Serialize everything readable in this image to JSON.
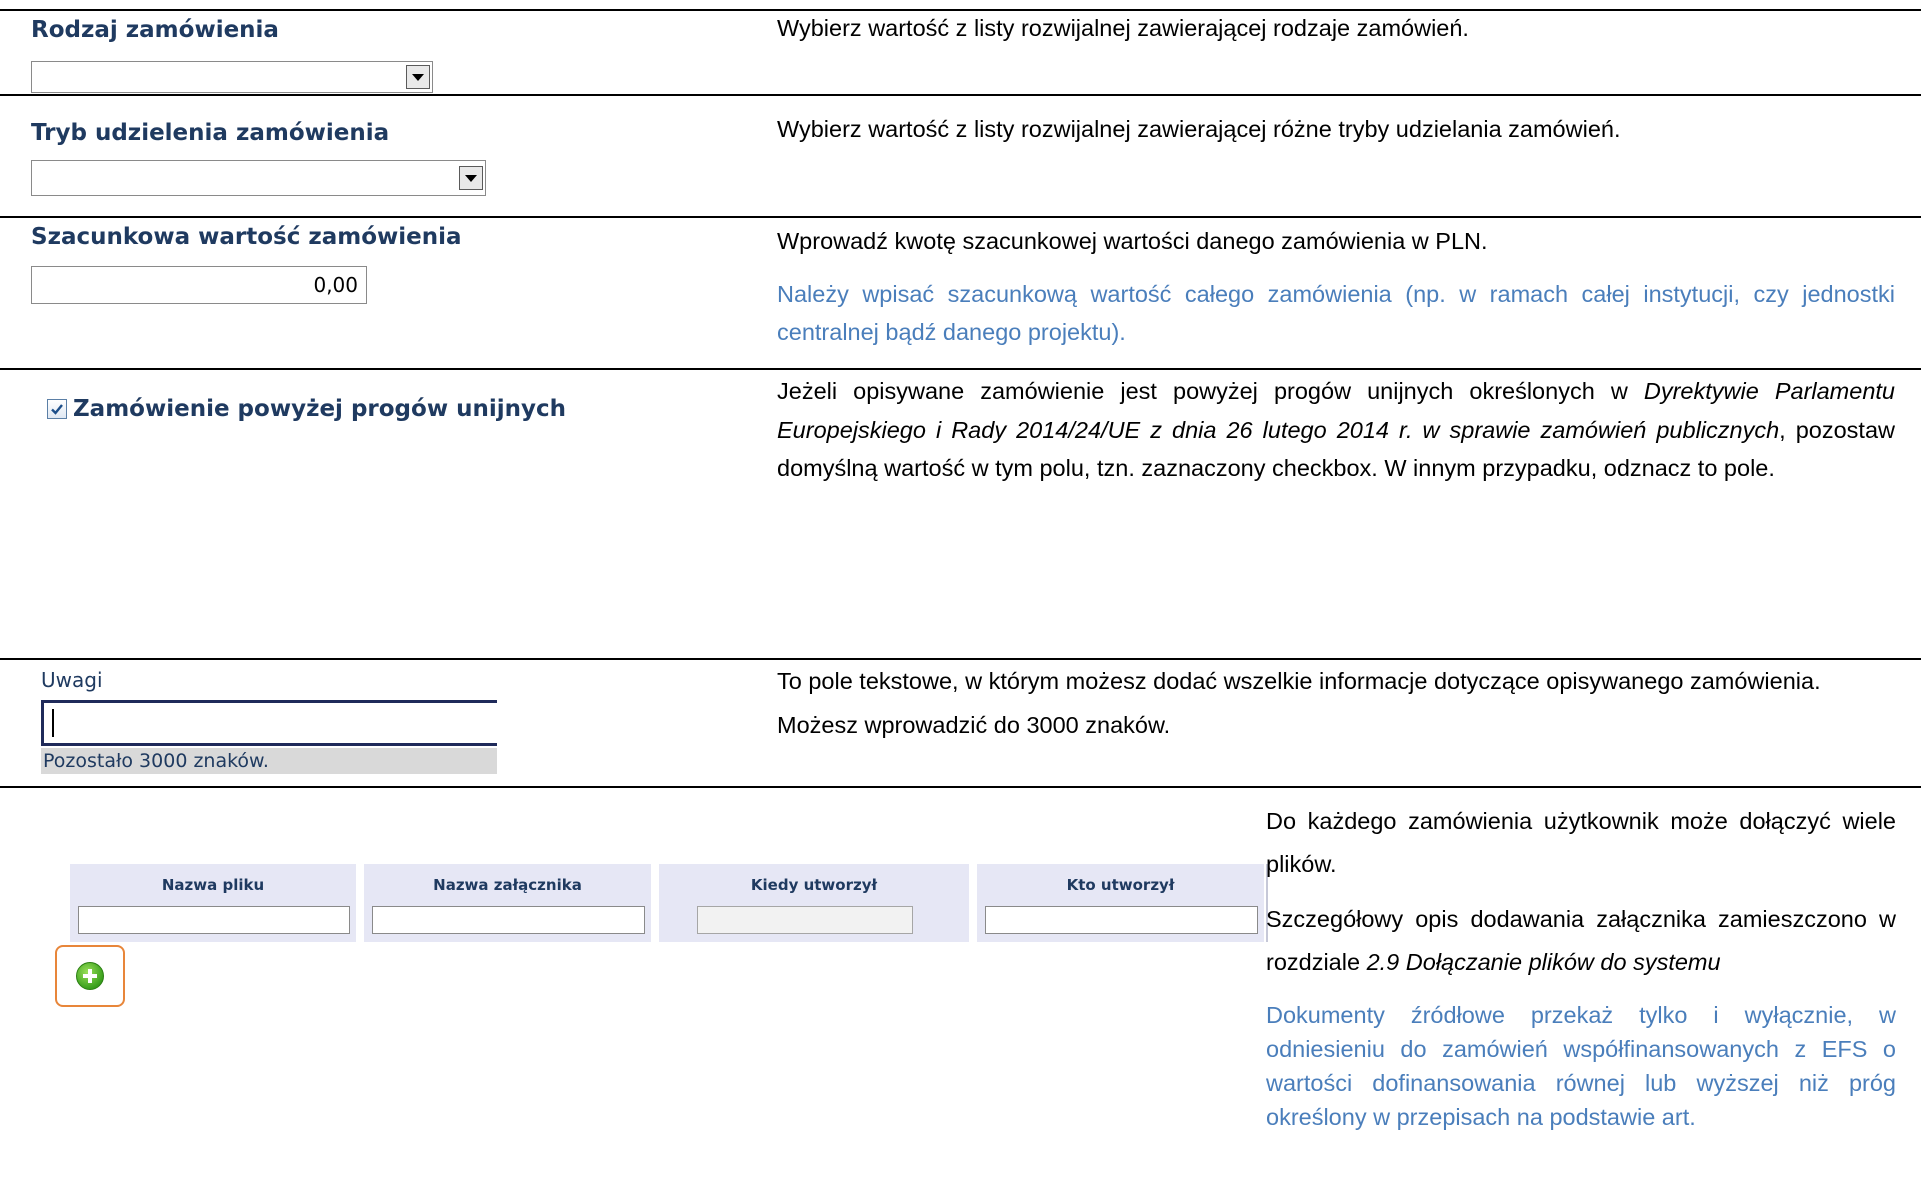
{
  "rodzaj": {
    "label": "Rodzaj zamówienia",
    "selected": "",
    "desc": "Wybierz wartość z listy rozwijalnej zawierającej rodzaje zamówień."
  },
  "tryb": {
    "label": "Tryb udzielenia zamówienia",
    "selected": "",
    "desc": "Wybierz wartość z listy rozwijalnej zawierającej różne tryby udzielania zamówień."
  },
  "szacunkowa": {
    "label": "Szacunkowa wartość zamówienia",
    "value": "0,00",
    "desc": "Wprowadź kwotę szacunkowej wartości danego zamówienia w PLN.",
    "note": "Należy wpisać szacunkową wartość całego zamówienia (np. w ramach całej instytucji, czy jednostki centralnej bądź danego projektu)."
  },
  "progi": {
    "label": "Zamówienie powyżej progów unijnych",
    "checked": true,
    "desc_1": "Jeżeli opisywane zamówienie jest powyżej progów unijnych określonych w ",
    "desc_italic": "Dyrektywie Parlamentu Europejskiego i Rady 2014/24/UE z dnia 26 lutego 2014 r. w sprawie zamówień publicznych",
    "desc_2": ", pozostaw domyślną wartość w tym polu, tzn. zaznaczony checkbox. W innym przypadku, odznacz to pole."
  },
  "uwagi": {
    "label": "Uwagi",
    "value": "",
    "remaining": "Pozostało 3000 znaków.",
    "desc_1": "To pole tekstowe, w którym możesz dodać wszelkie informacje dotyczące opisywanego zamówienia.",
    "desc_2": "Możesz wprowadzić do 3000 znaków."
  },
  "zalaczniki": {
    "columns": [
      "Nazwa pliku",
      "Nazwa załącznika",
      "Kiedy utworzył",
      "Kto utworzył"
    ],
    "desc_1": "Do każdego zamówienia użytkownik może dołączyć wiele plików.",
    "desc_2a": "Szczegółowy opis dodawania załącznika zamieszczono w rozdziale ",
    "desc_2italic": "2.9 Dołączanie plików do systemu",
    "desc_3": "Dokumenty źródłowe przekaż tylko i wyłącznie, w odniesieniu do zamówień współfinansowanych z EFS o wartości dofinansowania równej lub wyższej niż próg określony w przepisach na podstawie art."
  },
  "icons": {
    "add": "add-plus-icon",
    "dropdown": "chevron-down-icon",
    "checkbox": "checkmark-icon"
  },
  "colors": {
    "label": "#1f3a60",
    "note_blue": "#4a7ebb",
    "accent_orange": "#e8863a",
    "table_header": "#e6e7f5"
  }
}
